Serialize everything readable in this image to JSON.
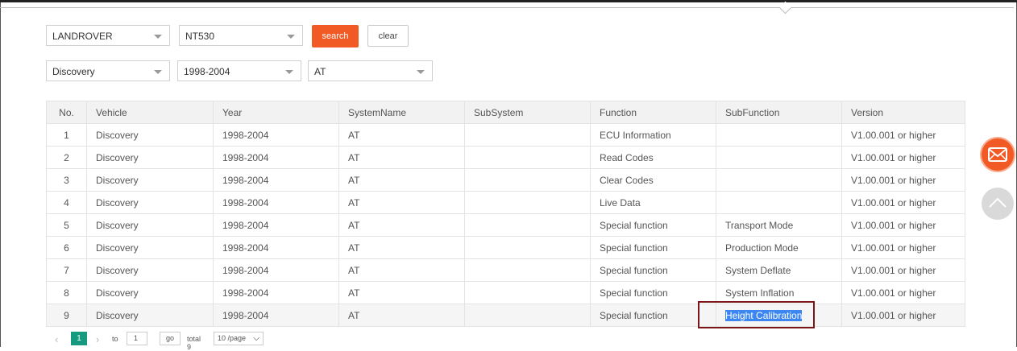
{
  "filters": {
    "brand": "LANDROVER",
    "tool": "NT530",
    "model": "Discovery",
    "year": "1998-2004",
    "system": "AT",
    "search_label": "search",
    "clear_label": "clear"
  },
  "table": {
    "headers": [
      "No.",
      "Vehicle",
      "Year",
      "SystemName",
      "SubSystem",
      "Function",
      "SubFunction",
      "Version"
    ],
    "rows": [
      {
        "no": "1",
        "vehicle": "Discovery",
        "year": "1998-2004",
        "system": "AT",
        "subsystem": "",
        "function": "ECU Information",
        "subfunction": "",
        "version": "V1.00.001 or higher"
      },
      {
        "no": "2",
        "vehicle": "Discovery",
        "year": "1998-2004",
        "system": "AT",
        "subsystem": "",
        "function": "Read Codes",
        "subfunction": "",
        "version": "V1.00.001 or higher"
      },
      {
        "no": "3",
        "vehicle": "Discovery",
        "year": "1998-2004",
        "system": "AT",
        "subsystem": "",
        "function": "Clear Codes",
        "subfunction": "",
        "version": "V1.00.001 or higher"
      },
      {
        "no": "4",
        "vehicle": "Discovery",
        "year": "1998-2004",
        "system": "AT",
        "subsystem": "",
        "function": "Live Data",
        "subfunction": "",
        "version": "V1.00.001 or higher"
      },
      {
        "no": "5",
        "vehicle": "Discovery",
        "year": "1998-2004",
        "system": "AT",
        "subsystem": "",
        "function": "Special function",
        "subfunction": "Transport Mode",
        "version": "V1.00.001 or higher"
      },
      {
        "no": "6",
        "vehicle": "Discovery",
        "year": "1998-2004",
        "system": "AT",
        "subsystem": "",
        "function": "Special function",
        "subfunction": "Production Mode",
        "version": "V1.00.001 or higher"
      },
      {
        "no": "7",
        "vehicle": "Discovery",
        "year": "1998-2004",
        "system": "AT",
        "subsystem": "",
        "function": "Special function",
        "subfunction": "System Deflate",
        "version": "V1.00.001 or higher"
      },
      {
        "no": "8",
        "vehicle": "Discovery",
        "year": "1998-2004",
        "system": "AT",
        "subsystem": "",
        "function": "Special function",
        "subfunction": "System Inflation",
        "version": "V1.00.001 or higher"
      },
      {
        "no": "9",
        "vehicle": "Discovery",
        "year": "1998-2004",
        "system": "AT",
        "subsystem": "",
        "function": "Special function",
        "subfunction": "Height Calibration",
        "version": "V1.00.001 or higher"
      }
    ]
  },
  "pagination": {
    "current_page": "1",
    "to_label": "to",
    "page_input": "1",
    "go_label": "go",
    "total_label": "total 9",
    "per_page": "10 /page"
  },
  "icons": {
    "prev": "chevron-left-icon",
    "next": "chevron-right-icon",
    "mail": "mail-icon",
    "back_to_top": "chevron-up-icon"
  },
  "colors": {
    "accent": "#f25a25",
    "page_active": "#159a80",
    "annotation": "#7a1518",
    "selection": "#3b86f0"
  }
}
